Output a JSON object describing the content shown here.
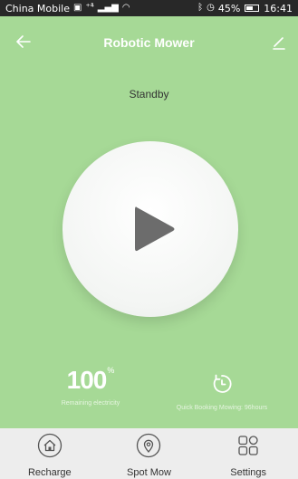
{
  "status_bar": {
    "carrier": "China Mobile",
    "signal_text": "⁺⁴̇",
    "battery_percent": "45%",
    "time": "16:41"
  },
  "header": {
    "title": "Robotic Mower",
    "back_icon": "back-arrow-icon",
    "edit_icon": "edit-pencil-icon"
  },
  "mower": {
    "status": "Standby",
    "start_icon": "play-icon"
  },
  "stats": {
    "battery_value": "100",
    "battery_unit": "%",
    "battery_label": "Remaining electricity",
    "booking_label": "Quick Booking Mowing: 96hours",
    "booking_icon": "timer-icon"
  },
  "nav": {
    "items": [
      {
        "label": "Recharge",
        "icon": "home-icon"
      },
      {
        "label": "Spot Mow",
        "icon": "location-pin-icon"
      },
      {
        "label": "Settings",
        "icon": "grid-icon"
      }
    ]
  },
  "colors": {
    "background": "#a6d996",
    "status_bar": "#282828",
    "bottom_bar": "#ededed",
    "icon": "#555555"
  }
}
